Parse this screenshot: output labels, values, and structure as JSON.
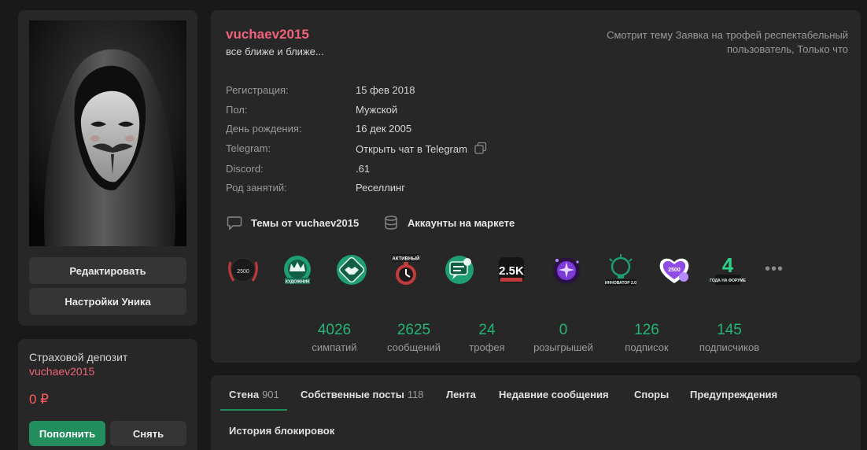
{
  "profile": {
    "username": "vuchaev2015",
    "status_text": "все ближе и ближе...",
    "activity": "Смотрит тему Заявка на трофей респектабельный пользователь, Только что"
  },
  "buttons": {
    "edit": "Редактировать",
    "unik_settings": "Настройки Уника"
  },
  "deposit": {
    "title": "Страховой депозит",
    "user": "vuchaev2015",
    "amount": "0 ₽",
    "topup": "Пополнить",
    "withdraw": "Снять"
  },
  "info": [
    {
      "label": "Регистрация:",
      "value": "15 фев 2018"
    },
    {
      "label": "Пол:",
      "value": "Мужской"
    },
    {
      "label": "День рождения:",
      "value": "16 дек 2005"
    },
    {
      "label": "Telegram:",
      "value": "Открыть чат в Telegram"
    },
    {
      "label": "Discord:",
      "value": ".61"
    },
    {
      "label": "Род занятий:",
      "value": "Реселлинг"
    }
  ],
  "links": {
    "threads": "Темы от vuchaev2015",
    "market": "Аккаунты на маркете"
  },
  "trophies": {
    "t1": {
      "icon": "sympathy-2500-trophy-icon",
      "text": "2500",
      "color": "#c23b3b"
    },
    "t2": {
      "icon": "crown-trophy-icon",
      "text": "ХУДОЖНИК",
      "color": "#1f9e74"
    },
    "t3": {
      "icon": "handshake-trophy-icon",
      "color": "#1f9e74"
    },
    "t4": {
      "icon": "active-stopwatch-trophy-icon",
      "text": "АКТИВНЫЙ",
      "color": "#c23b3b"
    },
    "t5": {
      "icon": "forum-chat-trophy-icon",
      "color": "#1f9e74"
    },
    "t6": {
      "icon": "2.5k-trophy-icon",
      "text": "2.5K",
      "color": "#c23b3b"
    },
    "t7": {
      "icon": "purple-idea-trophy-icon",
      "color": "#7b3ad6"
    },
    "t8": {
      "icon": "innovator-bulb-trophy-icon",
      "text": "ИННОВАТОР 2.0",
      "color": "#1f9e74"
    },
    "t9": {
      "icon": "heart-2500-trophy-icon",
      "text": "2500",
      "color": "#8f4be6"
    },
    "t10": {
      "icon": "4-years-on-forum-trophy-icon",
      "text": "4",
      "sub": "ГОДА НА ФОРУМЕ",
      "color": "#2ed08a"
    }
  },
  "stats": [
    {
      "value": "4026",
      "label": "симпатий"
    },
    {
      "value": "2625",
      "label": "сообщений"
    },
    {
      "value": "24",
      "label": "трофея"
    },
    {
      "value": "0",
      "label": "розыгрышей"
    },
    {
      "value": "126",
      "label": "подписок"
    },
    {
      "value": "145",
      "label": "подписчиков"
    }
  ],
  "tabs": {
    "wall": {
      "label": "Стена",
      "count": "901"
    },
    "own_posts": {
      "label": "Собственные посты",
      "count": "118"
    },
    "feed": {
      "label": "Лента"
    },
    "recent": {
      "label": "Недавние сообщения"
    },
    "disputes": {
      "label": "Споры"
    },
    "warnings": {
      "label": "Предупреждения"
    },
    "bans": {
      "label": "История блокировок"
    }
  },
  "colors": {
    "accent_green": "#228e5d",
    "stat_green": "#24b574",
    "username_pink": "#f0637a",
    "panel_bg": "#272727",
    "page_bg": "#191919"
  }
}
